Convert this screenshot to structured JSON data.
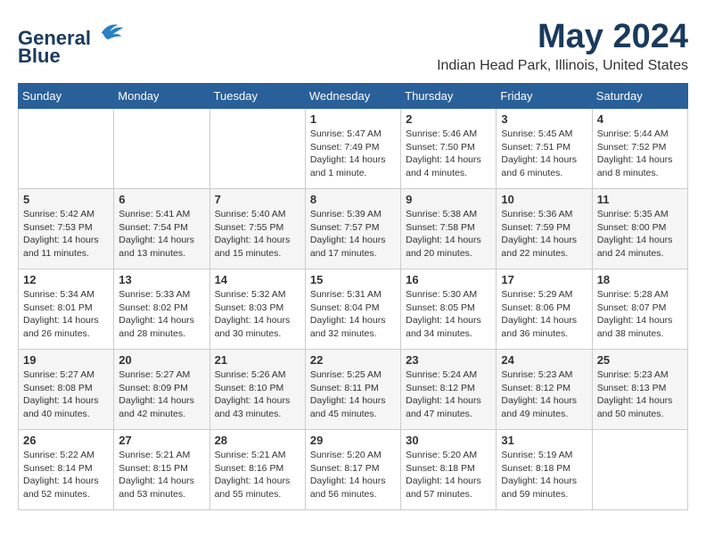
{
  "logo": {
    "line1": "General",
    "line2": "Blue"
  },
  "title": "May 2024",
  "location": "Indian Head Park, Illinois, United States",
  "weekdays": [
    "Sunday",
    "Monday",
    "Tuesday",
    "Wednesday",
    "Thursday",
    "Friday",
    "Saturday"
  ],
  "weeks": [
    [
      {
        "day": "",
        "info": ""
      },
      {
        "day": "",
        "info": ""
      },
      {
        "day": "",
        "info": ""
      },
      {
        "day": "1",
        "info": "Sunrise: 5:47 AM\nSunset: 7:49 PM\nDaylight: 14 hours\nand 1 minute."
      },
      {
        "day": "2",
        "info": "Sunrise: 5:46 AM\nSunset: 7:50 PM\nDaylight: 14 hours\nand 4 minutes."
      },
      {
        "day": "3",
        "info": "Sunrise: 5:45 AM\nSunset: 7:51 PM\nDaylight: 14 hours\nand 6 minutes."
      },
      {
        "day": "4",
        "info": "Sunrise: 5:44 AM\nSunset: 7:52 PM\nDaylight: 14 hours\nand 8 minutes."
      }
    ],
    [
      {
        "day": "5",
        "info": "Sunrise: 5:42 AM\nSunset: 7:53 PM\nDaylight: 14 hours\nand 11 minutes."
      },
      {
        "day": "6",
        "info": "Sunrise: 5:41 AM\nSunset: 7:54 PM\nDaylight: 14 hours\nand 13 minutes."
      },
      {
        "day": "7",
        "info": "Sunrise: 5:40 AM\nSunset: 7:55 PM\nDaylight: 14 hours\nand 15 minutes."
      },
      {
        "day": "8",
        "info": "Sunrise: 5:39 AM\nSunset: 7:57 PM\nDaylight: 14 hours\nand 17 minutes."
      },
      {
        "day": "9",
        "info": "Sunrise: 5:38 AM\nSunset: 7:58 PM\nDaylight: 14 hours\nand 20 minutes."
      },
      {
        "day": "10",
        "info": "Sunrise: 5:36 AM\nSunset: 7:59 PM\nDaylight: 14 hours\nand 22 minutes."
      },
      {
        "day": "11",
        "info": "Sunrise: 5:35 AM\nSunset: 8:00 PM\nDaylight: 14 hours\nand 24 minutes."
      }
    ],
    [
      {
        "day": "12",
        "info": "Sunrise: 5:34 AM\nSunset: 8:01 PM\nDaylight: 14 hours\nand 26 minutes."
      },
      {
        "day": "13",
        "info": "Sunrise: 5:33 AM\nSunset: 8:02 PM\nDaylight: 14 hours\nand 28 minutes."
      },
      {
        "day": "14",
        "info": "Sunrise: 5:32 AM\nSunset: 8:03 PM\nDaylight: 14 hours\nand 30 minutes."
      },
      {
        "day": "15",
        "info": "Sunrise: 5:31 AM\nSunset: 8:04 PM\nDaylight: 14 hours\nand 32 minutes."
      },
      {
        "day": "16",
        "info": "Sunrise: 5:30 AM\nSunset: 8:05 PM\nDaylight: 14 hours\nand 34 minutes."
      },
      {
        "day": "17",
        "info": "Sunrise: 5:29 AM\nSunset: 8:06 PM\nDaylight: 14 hours\nand 36 minutes."
      },
      {
        "day": "18",
        "info": "Sunrise: 5:28 AM\nSunset: 8:07 PM\nDaylight: 14 hours\nand 38 minutes."
      }
    ],
    [
      {
        "day": "19",
        "info": "Sunrise: 5:27 AM\nSunset: 8:08 PM\nDaylight: 14 hours\nand 40 minutes."
      },
      {
        "day": "20",
        "info": "Sunrise: 5:27 AM\nSunset: 8:09 PM\nDaylight: 14 hours\nand 42 minutes."
      },
      {
        "day": "21",
        "info": "Sunrise: 5:26 AM\nSunset: 8:10 PM\nDaylight: 14 hours\nand 43 minutes."
      },
      {
        "day": "22",
        "info": "Sunrise: 5:25 AM\nSunset: 8:11 PM\nDaylight: 14 hours\nand 45 minutes."
      },
      {
        "day": "23",
        "info": "Sunrise: 5:24 AM\nSunset: 8:12 PM\nDaylight: 14 hours\nand 47 minutes."
      },
      {
        "day": "24",
        "info": "Sunrise: 5:23 AM\nSunset: 8:12 PM\nDaylight: 14 hours\nand 49 minutes."
      },
      {
        "day": "25",
        "info": "Sunrise: 5:23 AM\nSunset: 8:13 PM\nDaylight: 14 hours\nand 50 minutes."
      }
    ],
    [
      {
        "day": "26",
        "info": "Sunrise: 5:22 AM\nSunset: 8:14 PM\nDaylight: 14 hours\nand 52 minutes."
      },
      {
        "day": "27",
        "info": "Sunrise: 5:21 AM\nSunset: 8:15 PM\nDaylight: 14 hours\nand 53 minutes."
      },
      {
        "day": "28",
        "info": "Sunrise: 5:21 AM\nSunset: 8:16 PM\nDaylight: 14 hours\nand 55 minutes."
      },
      {
        "day": "29",
        "info": "Sunrise: 5:20 AM\nSunset: 8:17 PM\nDaylight: 14 hours\nand 56 minutes."
      },
      {
        "day": "30",
        "info": "Sunrise: 5:20 AM\nSunset: 8:18 PM\nDaylight: 14 hours\nand 57 minutes."
      },
      {
        "day": "31",
        "info": "Sunrise: 5:19 AM\nSunset: 8:18 PM\nDaylight: 14 hours\nand 59 minutes."
      },
      {
        "day": "",
        "info": ""
      }
    ]
  ]
}
